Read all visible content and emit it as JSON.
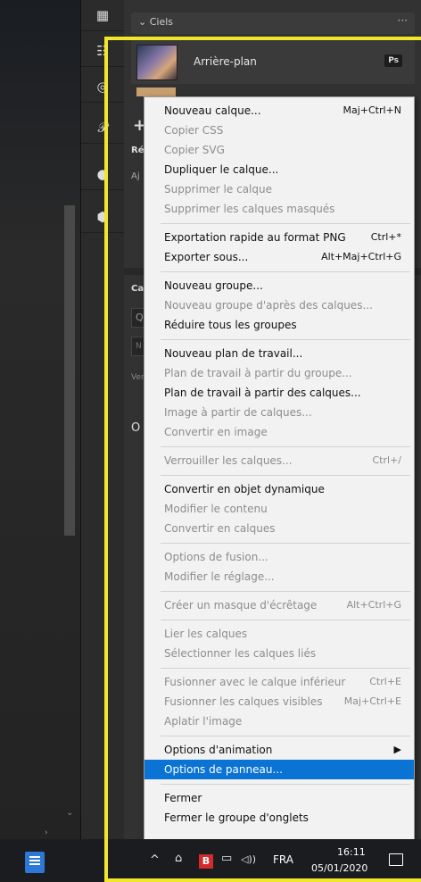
{
  "panel": {
    "title": "Ciels",
    "menu_dots": "···",
    "layer_name": "Arrière-plan",
    "layer_badge": "Ps",
    "add_symbol": "+",
    "section_re": "Ré",
    "section_aj": "Aj",
    "section_ca": "Ca",
    "search_glyph": "Q",
    "ne_label": "N",
    "ver_label": "Ver",
    "eye_glyph": "O"
  },
  "tools": [
    "grid-icon",
    "brush-list-icon",
    "target-icon",
    "script-p-icon",
    "radio-icon",
    "cube-icon"
  ],
  "menu": {
    "items": [
      {
        "label": "Nouveau calque...",
        "shortcut": "Maj+Ctrl+N",
        "enabled": true
      },
      {
        "label": "Copier CSS",
        "shortcut": "",
        "enabled": false
      },
      {
        "label": "Copier SVG",
        "shortcut": "",
        "enabled": false
      },
      {
        "label": "Dupliquer le calque...",
        "shortcut": "",
        "enabled": true
      },
      {
        "label": "Supprimer le calque",
        "shortcut": "",
        "enabled": false
      },
      {
        "label": "Supprimer les calques masqués",
        "shortcut": "",
        "enabled": false
      },
      {
        "label": "Exportation rapide au format PNG",
        "shortcut": "Ctrl+*",
        "enabled": true
      },
      {
        "label": "Exporter sous...",
        "shortcut": "Alt+Maj+Ctrl+G",
        "enabled": true
      },
      {
        "label": "Nouveau groupe...",
        "shortcut": "",
        "enabled": true
      },
      {
        "label": "Nouveau groupe d'après des calques...",
        "shortcut": "",
        "enabled": false
      },
      {
        "label": "Réduire tous les groupes",
        "shortcut": "",
        "enabled": true
      },
      {
        "label": "Nouveau plan de travail...",
        "shortcut": "",
        "enabled": true
      },
      {
        "label": "Plan de travail à partir du groupe...",
        "shortcut": "",
        "enabled": false
      },
      {
        "label": "Plan de travail à partir des calques...",
        "shortcut": "",
        "enabled": true
      },
      {
        "label": "Image à partir de calques...",
        "shortcut": "",
        "enabled": false
      },
      {
        "label": "Convertir en image",
        "shortcut": "",
        "enabled": false
      },
      {
        "label": "Verrouiller les calques...",
        "shortcut": "Ctrl+/",
        "enabled": false
      },
      {
        "label": "Convertir en objet dynamique",
        "shortcut": "",
        "enabled": true
      },
      {
        "label": "Modifier le contenu",
        "shortcut": "",
        "enabled": false
      },
      {
        "label": "Convertir en calques",
        "shortcut": "",
        "enabled": false
      },
      {
        "label": "Options de fusion...",
        "shortcut": "",
        "enabled": false
      },
      {
        "label": "Modifier le réglage...",
        "shortcut": "",
        "enabled": false
      },
      {
        "label": "Créer un masque d'écrêtage",
        "shortcut": "Alt+Ctrl+G",
        "enabled": false
      },
      {
        "label": "Lier les calques",
        "shortcut": "",
        "enabled": false
      },
      {
        "label": "Sélectionner les calques liés",
        "shortcut": "",
        "enabled": false
      },
      {
        "label": "Fusionner avec le calque inférieur",
        "shortcut": "Ctrl+E",
        "enabled": false
      },
      {
        "label": "Fusionner les calques visibles",
        "shortcut": "Maj+Ctrl+E",
        "enabled": false
      },
      {
        "label": "Aplatir l'image",
        "shortcut": "",
        "enabled": false
      },
      {
        "label": "Options d'animation",
        "shortcut": "▶",
        "enabled": true
      },
      {
        "label": "Options de panneau...",
        "shortcut": "",
        "enabled": true,
        "highlighted": true
      },
      {
        "label": "Fermer",
        "shortcut": "",
        "enabled": true
      },
      {
        "label": "Fermer le groupe d'onglets",
        "shortcut": "",
        "enabled": true
      }
    ],
    "highlight_color": "#0a73d4"
  },
  "taskbar": {
    "up_arrow": "^",
    "b_badge": "B",
    "volume": "◁))",
    "language": "FRA",
    "time": "16:11",
    "date": "05/01/2020"
  },
  "accent": "#f0e62a"
}
